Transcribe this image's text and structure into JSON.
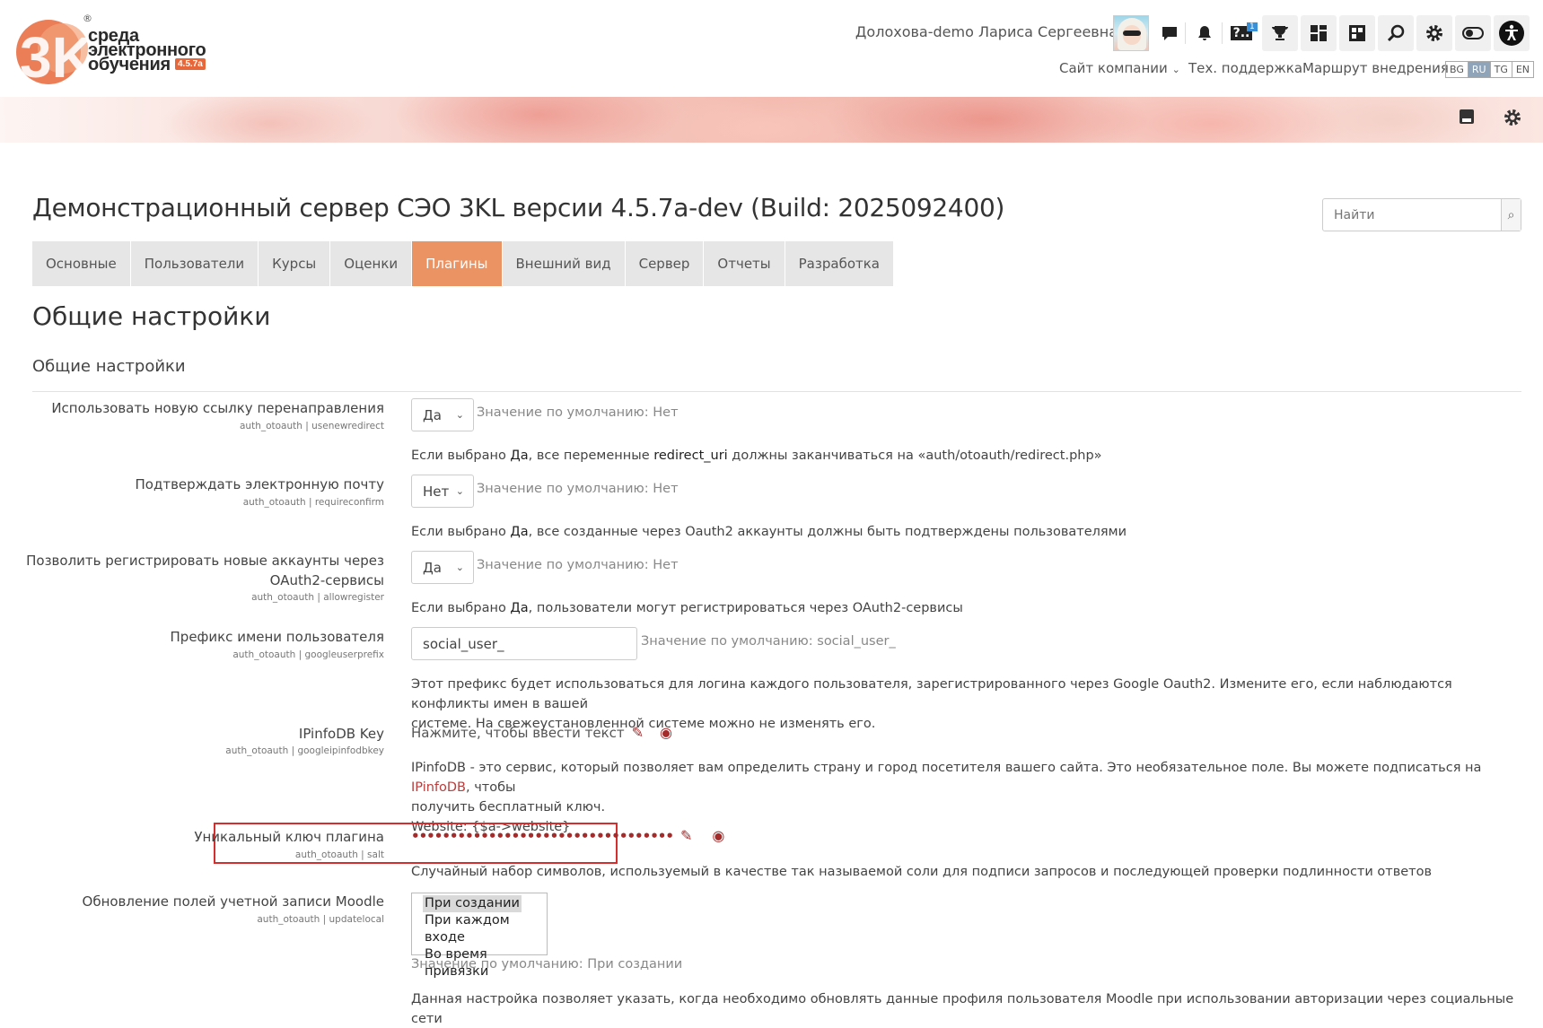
{
  "logo": {
    "brand_number": "3K",
    "line1": "среда",
    "line2": "электронного",
    "line3": "обучения",
    "version": "4.5.7a",
    "registered": "®"
  },
  "header": {
    "user_name": "Долохова-demo Лариса Сергеевна",
    "links": {
      "company_site": "Сайт компании",
      "support": "Тех. поддержка",
      "route": "Маршрут внедрения"
    },
    "help_badge": "1",
    "languages": [
      "BG",
      "RU",
      "TG",
      "EN"
    ],
    "active_language": "RU"
  },
  "page": {
    "title": "Демонстрационный сервер СЭО 3KL версии 4.5.7a-dev (Build: 2025092400)",
    "search_placeholder": "Найти",
    "tabs": [
      "Основные",
      "Пользователи",
      "Курсы",
      "Оценки",
      "Плагины",
      "Внешний вид",
      "Сервер",
      "Отчеты",
      "Разработка"
    ],
    "active_tab": "Плагины",
    "heading": "Общие настройки",
    "section_heading": "Общие настройки"
  },
  "settings": {
    "usenewredirect": {
      "label": "Использовать новую ссылку перенаправления",
      "key": "auth_otoauth | usenewredirect",
      "value": "Да",
      "default": "Значение по умолчанию: Нет",
      "desc_pre": "Если выбрано ",
      "desc_bold": "Да",
      "desc_mid": ", все переменные ",
      "desc_bold2": "redirect_uri",
      "desc_post": " должны заканчиваться на «auth/otoauth/redirect.php»"
    },
    "requireconfirm": {
      "label": "Подтверждать электронную почту",
      "key": "auth_otoauth | requireconfirm",
      "value": "Нет",
      "default": "Значение по умолчанию: Нет",
      "desc_pre": "Если выбрано ",
      "desc_bold": "Да",
      "desc_post": ", все созданные через Oauth2 аккаунты должны быть подтверждены пользователями"
    },
    "allowregister": {
      "label_line1": "Позволить регистрировать новые аккаунты через",
      "label_line2": "OAuth2-сервисы",
      "key": "auth_otoauth | allowregister",
      "value": "Да",
      "default": "Значение по умолчанию: Нет",
      "desc_pre": "Если выбрано ",
      "desc_bold": "Да",
      "desc_post": ", пользователи могут регистрироваться через OAuth2-сервисы"
    },
    "googleuserprefix": {
      "label": "Префикс имени пользователя",
      "key": "auth_otoauth | googleuserprefix",
      "value": "social_user_",
      "default": "Значение по умолчанию: social_user_",
      "desc_line1": "Этот префикс будет использоваться для логина каждого пользователя, зарегистрированного через Google Oauth2. Измените его, если наблюдаются конфликты имен в вашей",
      "desc_line2": "системе. На свежеустановленной системе можно не изменять его."
    },
    "googleipinfodbkey": {
      "label": "IPinfoDB Key",
      "key": "auth_otoauth | googleipinfodbkey",
      "value": "Нажмите, чтобы ввести текст",
      "desc_pre": "IPinfoDB - это сервис, который позволяет вам определить страну и город посетителя вашего сайта. Это необязательное поле. Вы можете подписаться на ",
      "desc_link": "IPinfoDB",
      "desc_post": ", чтобы",
      "desc_line2": "получить бесплатный ключ.",
      "desc_line3": "Website: {$a->website}"
    },
    "salt": {
      "label": "Уникальный ключ плагина",
      "key": "auth_otoauth | salt",
      "value": "••••••••••••••••••••••••••••••••••",
      "desc": "Случайный набор символов, используемый в качестве так называемой соли для подписи запросов и последующей проверки подлинности ответов"
    },
    "updatelocal": {
      "label": "Обновление полей учетной записи Moodle",
      "key": "auth_otoauth | updatelocal",
      "options": [
        "При создании",
        "При каждом входе",
        "Во время привязки"
      ],
      "selected": "При создании",
      "default": "Значение по умолчанию: При создании",
      "desc": "Данная настройка позволяет указать, когда необходимо обновлять данные профиля пользователя Moodle при использовании авторизации через социальные сети"
    }
  }
}
